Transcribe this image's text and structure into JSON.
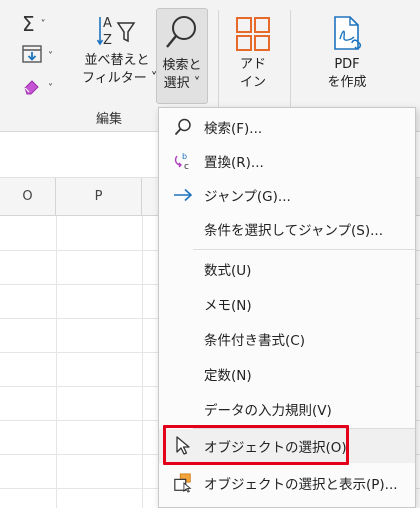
{
  "ribbon": {
    "sort_filter_label_1": "並べ替えと",
    "sort_filter_label_2": "フィルター ˅",
    "find_select_label_1": "検索と",
    "find_select_label_2": "選択 ˅",
    "addin_label_1": "アド",
    "addin_label_2": "イン",
    "pdf_label_1": "PDF",
    "pdf_label_2": "を作成",
    "group_label": "編集"
  },
  "sheet": {
    "columns": [
      "O",
      "P"
    ]
  },
  "menu": {
    "items": [
      {
        "label": "検索(F)...",
        "icon": "search-icon"
      },
      {
        "label": "置換(R)...",
        "icon": "replace-icon"
      },
      {
        "label": "ジャンプ(G)...",
        "icon": "arrow-right-icon"
      },
      {
        "label": "条件を選択してジャンプ(S)...",
        "icon": ""
      },
      {
        "label": "数式(U)",
        "icon": ""
      },
      {
        "label": "メモ(N)",
        "icon": ""
      },
      {
        "label": "条件付き書式(C)",
        "icon": ""
      },
      {
        "label": "定数(N)",
        "icon": ""
      },
      {
        "label": "データの入力規則(V)",
        "icon": ""
      },
      {
        "label": "オブジェクトの選択(O)",
        "icon": "cursor-pointer-icon"
      },
      {
        "label": "オブジェクトの選択と表示(P)...",
        "icon": "selection-pane-icon"
      }
    ]
  },
  "colors": {
    "accent_blue": "#1e73be",
    "addin_orange": "#e86a2a",
    "highlight_red": "#e3001b",
    "eraser_purple": "#b040c0"
  }
}
